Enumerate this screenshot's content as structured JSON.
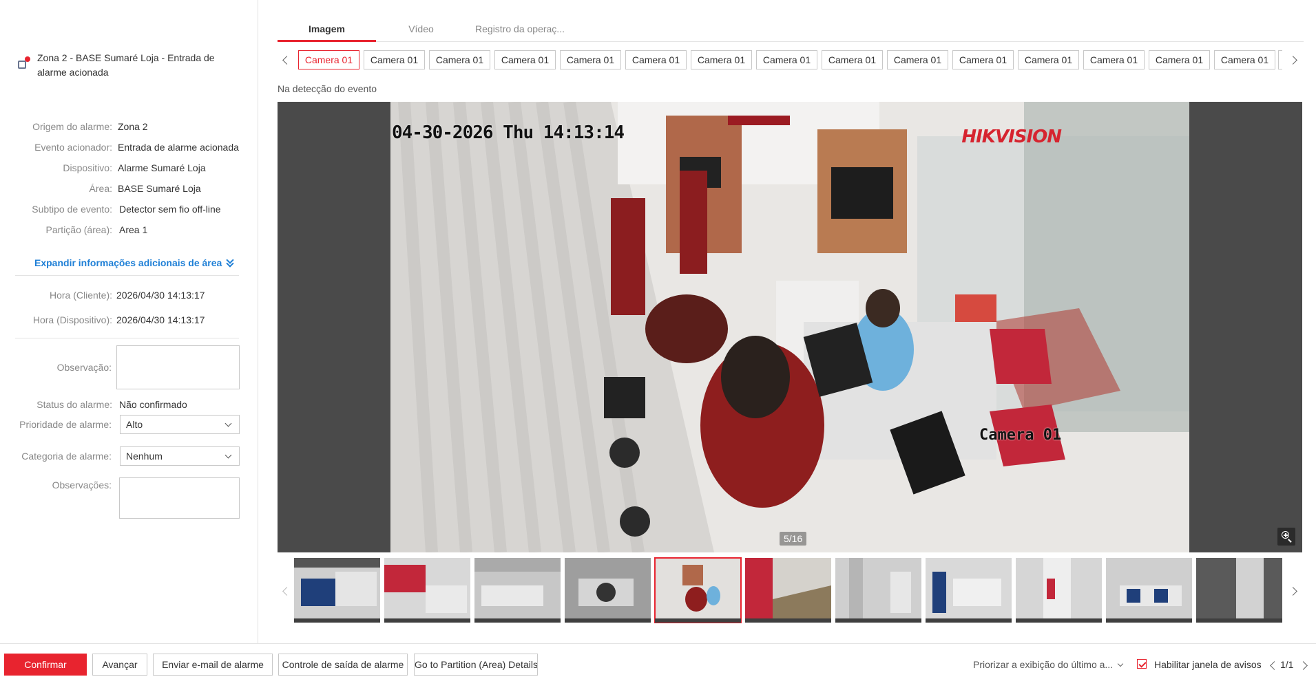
{
  "alarm": {
    "title": "Zona 2 - BASE Sumaré Loja - Entrada de alarme acionada",
    "details": [
      {
        "label": "Origem do alarme:",
        "value": "Zona 2"
      },
      {
        "label": "Evento acionador:",
        "value": "Entrada de alarme acionada"
      },
      {
        "label": "Dispositivo:",
        "value": "Alarme Sumaré Loja"
      },
      {
        "label": "Área:",
        "value": "BASE Sumaré Loja"
      },
      {
        "label": "Subtipo de evento:",
        "value": "Detector sem fio off-line"
      },
      {
        "label": "Partição (área):",
        "value": "Area 1"
      }
    ],
    "expand_label": "Expandir informações adicionais de área",
    "times": [
      {
        "label": "Hora (Cliente):",
        "value": "2026/04/30 14:13:17"
      },
      {
        "label": "Hora (Dispositivo):",
        "value": "2026/04/30 14:13:17"
      }
    ],
    "observacao_label": "Observação:",
    "observacao_value": "",
    "status_label": "Status do alarme:",
    "status_value": "Não confirmado",
    "priority_label": "Prioridade de alarme:",
    "priority_value": "Alto",
    "category_label": "Categoria de alarme:",
    "category_value": "Nenhum",
    "observacoes_label": "Observações:",
    "observacoes_value": ""
  },
  "tabs": [
    "Imagem",
    "Vídeo",
    "Registro da operaç..."
  ],
  "active_tab": 0,
  "cameras": [
    "Camera 01",
    "Camera 01",
    "Camera 01",
    "Camera 01",
    "Camera 01",
    "Camera 01",
    "Camera 01",
    "Camera 01",
    "Camera 01",
    "Camera 01",
    "Camera 01",
    "Camera 01",
    "Camera 01",
    "Camera 01",
    "Camera 01"
  ],
  "active_camera": 0,
  "viewer": {
    "caption": "Na detecção do evento",
    "osd_time": "04-30-2026 Thu 14:13:14",
    "osd_brand": "HIKVISION",
    "osd_camera": "Camera 01",
    "counter": "5/16",
    "active_thumb": 4,
    "thumb_count": 11
  },
  "footer": {
    "confirm": "Confirmar",
    "next": "Avançar",
    "email": "Enviar e-mail de alarme",
    "output": "Controle de saída de alarme",
    "partition": "Go to Partition (Area) Details",
    "priority_display": "Priorizar a exibição do último a...",
    "enable_popup": "Habilitar janela de avisos",
    "pager": "1/1"
  },
  "colors": {
    "accent": "#e8242f",
    "link": "#1e7fd6"
  },
  "icons": [
    "alarm-input-icon",
    "chevron-double-down-icon",
    "chevron-left-icon",
    "chevron-right-icon",
    "zoom-in-icon",
    "checkbox-checked-icon"
  ]
}
